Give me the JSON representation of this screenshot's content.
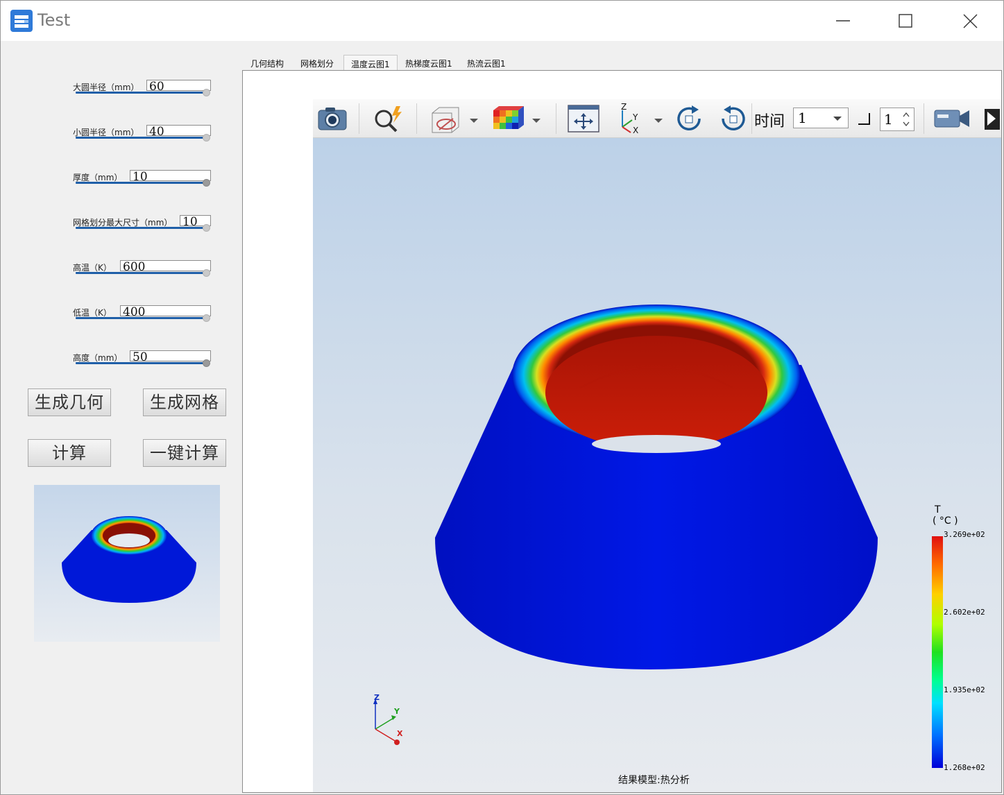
{
  "window": {
    "title": "Test"
  },
  "params": [
    {
      "label": "大圆半径（mm）",
      "value": "60",
      "progress": 1.0
    },
    {
      "label": "小圆半径（mm）",
      "value": "40",
      "progress": 1.0
    },
    {
      "label": "厚度（mm）",
      "value": "10",
      "progress": 1.0
    },
    {
      "label": "网格划分最大尺寸（mm）",
      "value": "10",
      "progress": 1.0
    },
    {
      "label": "高温（K）",
      "value": "600",
      "progress": 1.0
    },
    {
      "label": "低温（K）",
      "value": "400",
      "progress": 1.0
    },
    {
      "label": "高度（mm）",
      "value": "50",
      "progress": 1.0
    }
  ],
  "buttons": {
    "generate_geometry": "生成几何",
    "generate_mesh": "生成网格",
    "calculate": "计算",
    "one_click_calculate": "一键计算"
  },
  "tabs": [
    {
      "label": "几何结构",
      "active": false
    },
    {
      "label": "网格划分",
      "active": false
    },
    {
      "label": "温度云图1",
      "active": true
    },
    {
      "label": "热梯度云图1",
      "active": false
    },
    {
      "label": "热流云图1",
      "active": false
    }
  ],
  "toolbar": {
    "time_label": "时间",
    "time_value": "1",
    "step_value": "1",
    "icons": [
      "camera-icon",
      "zoom-icon",
      "hide-show-icon",
      "color-map-icon",
      "fit-view-icon",
      "axis-orientation-icon",
      "rotate-cw-icon",
      "rotate-ccw-icon",
      "record-video-icon"
    ]
  },
  "viewport": {
    "status": "结果模型:热分析",
    "axes": {
      "z": "Z",
      "y": "Y",
      "x": "X"
    }
  },
  "legend": {
    "title": "T",
    "unit": "( °C )",
    "ticks": [
      "3.269e+02",
      "2.602e+02",
      "1.935e+02",
      "1.268e+02"
    ],
    "colors": {
      "max": "#e01010",
      "mid": "#20e020",
      "min": "#0000d8"
    }
  },
  "colors": {
    "accent": "#1f5fa8",
    "app_logo": "#2f7ad8"
  }
}
